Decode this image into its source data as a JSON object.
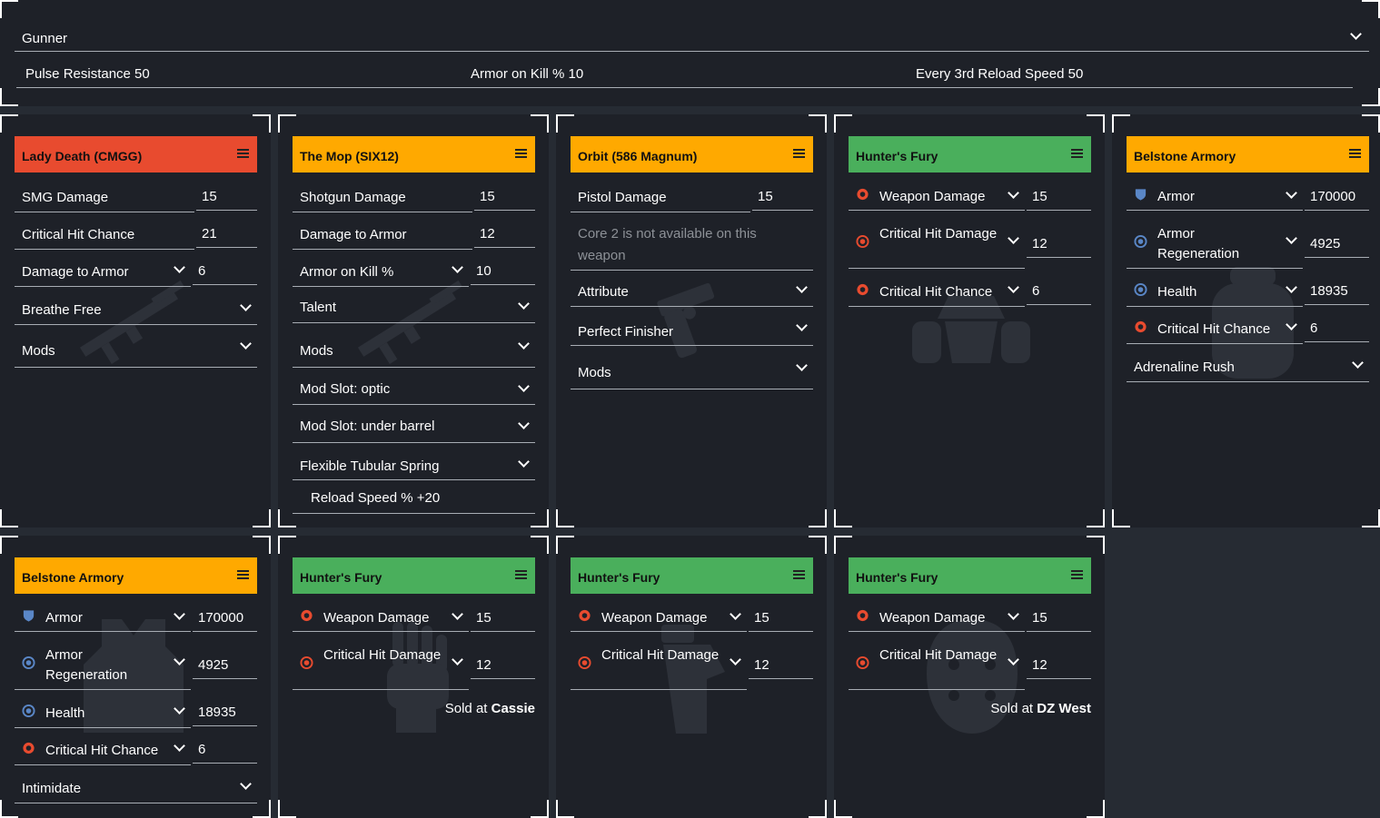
{
  "specialization": {
    "label": "Gunner"
  },
  "specialization_attributes": [
    {
      "label": "Pulse Resistance 50"
    },
    {
      "label": "Armor on Kill % 10"
    },
    {
      "label": "Every 3rd Reload Speed 50"
    }
  ],
  "cards": [
    {
      "title": "Lady Death (CMGG)",
      "color": "#e84b2f",
      "ghost": "rifle-icon",
      "rows": [
        {
          "label": "SMG Damage",
          "value": "15"
        },
        {
          "label": "Critical Hit Chance",
          "value": "21"
        },
        {
          "label": "Damage to Armor",
          "value": "6"
        },
        {
          "label": "Breathe Free"
        },
        {
          "label": "Mods"
        }
      ]
    },
    {
      "title": "The Mop (SIX12)",
      "color": "#ffa900",
      "ghost": "rifle-icon",
      "rows": [
        {
          "label": "Shotgun Damage",
          "value": "15"
        },
        {
          "label": "Damage to Armor",
          "value": "12"
        },
        {
          "label": "Armor on Kill %",
          "value": "10"
        },
        {
          "label": "Talent"
        },
        {
          "label": "Mods"
        },
        {
          "label": "Mod Slot: optic"
        },
        {
          "label": "Mod Slot: under barrel"
        },
        {
          "label": "Flexible Tubular Spring"
        }
      ],
      "mod_stat": "Reload Speed % +20"
    },
    {
      "title": "Orbit (586 Magnum)",
      "color": "#ffa900",
      "ghost": "pistol-icon",
      "rows": [
        {
          "label": "Pistol Damage",
          "value": "15"
        },
        {
          "label": "Attribute"
        },
        {
          "label": "Perfect Finisher"
        },
        {
          "label": "Mods"
        }
      ],
      "note": "Core 2 is not available on this weapon"
    },
    {
      "title": "Hunter's Fury",
      "color": "#4aaf5c",
      "ghost": "mask-icon",
      "rows": [
        {
          "label": "Weapon Damage",
          "value": "15"
        },
        {
          "label": "Critical Hit Damage",
          "value": "12"
        },
        {
          "label": "Critical Hit Chance",
          "value": "6"
        }
      ]
    },
    {
      "title": "Belstone Armory",
      "color": "#ffa900",
      "ghost": "backpack-icon",
      "rows": [
        {
          "label": "Armor",
          "value": "170000"
        },
        {
          "label": "Armor Regeneration",
          "value": "4925"
        },
        {
          "label": "Health",
          "value": "18935"
        },
        {
          "label": "Critical Hit Chance",
          "value": "6"
        },
        {
          "label": "Adrenaline Rush"
        }
      ]
    },
    {
      "title": "Belstone Armory",
      "color": "#ffa900",
      "ghost": "vest-icon",
      "rows": [
        {
          "label": "Armor",
          "value": "170000"
        },
        {
          "label": "Armor Regeneration",
          "value": "4925"
        },
        {
          "label": "Health",
          "value": "18935"
        },
        {
          "label": "Critical Hit Chance",
          "value": "6"
        },
        {
          "label": "Intimidate"
        }
      ]
    },
    {
      "title": "Hunter's Fury",
      "color": "#4aaf5c",
      "ghost": "glove-icon",
      "rows": [
        {
          "label": "Weapon Damage",
          "value": "15"
        },
        {
          "label": "Critical Hit Damage",
          "value": "12"
        }
      ],
      "sold_prefix": "Sold at",
      "sold_vendor": "Cassie"
    },
    {
      "title": "Hunter's Fury",
      "color": "#4aaf5c",
      "ghost": "holster-icon",
      "rows": [
        {
          "label": "Weapon Damage",
          "value": "15"
        },
        {
          "label": "Critical Hit Damage",
          "value": "12"
        }
      ]
    },
    {
      "title": "Hunter's Fury",
      "color": "#4aaf5c",
      "ghost": "kneepads-icon",
      "rows": [
        {
          "label": "Weapon Damage",
          "value": "15"
        },
        {
          "label": "Critical Hit Damage",
          "value": "12"
        }
      ],
      "sold_prefix": "Sold at",
      "sold_vendor": "DZ West"
    }
  ],
  "colors": {
    "page": "#262b33",
    "card": "#1e2128",
    "red": "#e84b2f",
    "orange": "#ffa900",
    "green": "#4aaf5c",
    "line": "#a8adb4",
    "muted": "#8d9197"
  }
}
